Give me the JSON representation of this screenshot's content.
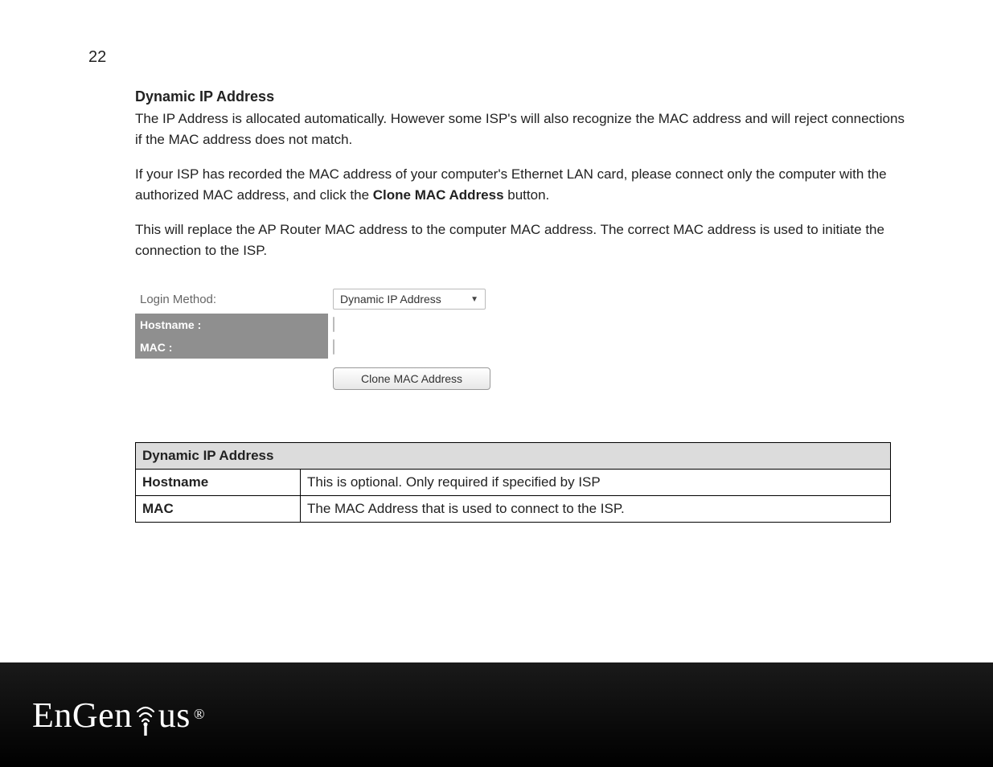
{
  "page_number": "22",
  "section_title": "Dynamic IP Address",
  "paragraphs": {
    "p1": "The IP Address is allocated automatically. However some ISP's will also recognize the MAC address and will reject connections if the MAC address does not match.",
    "p2a": "If your ISP has recorded the MAC address of your computer's Ethernet LAN card, please connect only the computer with the authorized MAC address, and click the ",
    "p2b_bold": "Clone MAC Address",
    "p2c": " button.",
    "p3": "This will replace the AP Router MAC address to the computer MAC address. The correct MAC address is used to initiate the connection to the ISP."
  },
  "form": {
    "login_method_label": "Login Method:",
    "login_method_value": "Dynamic IP Address",
    "hostname_label": "Hostname :",
    "hostname_value": "",
    "mac_label": "MAC :",
    "mac_value": "",
    "clone_button": "Clone MAC Address"
  },
  "table": {
    "header": "Dynamic IP Address",
    "rows": [
      {
        "key": "Hostname",
        "desc": "This is optional. Only required if specified by ISP"
      },
      {
        "key": "MAC",
        "desc": "The MAC Address that is used to connect to the ISP."
      }
    ]
  },
  "logo": {
    "text1": "EnGen",
    "text2": "us",
    "reg": "®"
  }
}
